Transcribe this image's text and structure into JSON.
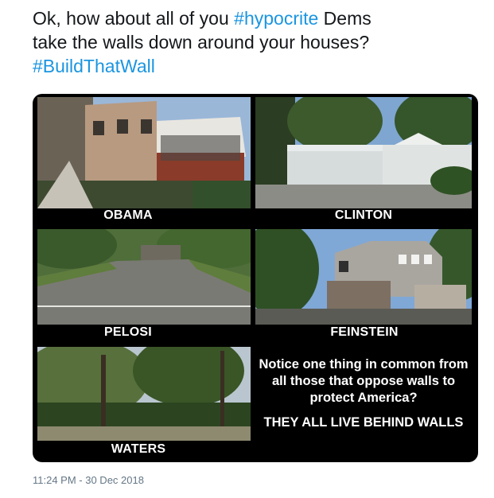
{
  "tweet": {
    "line1_prefix": "Ok, how about all of you ",
    "line1_hashtag": "#hypocrite",
    "line1_suffix": " Dems",
    "line2": "take the walls down around your houses?",
    "line3_hashtag": "#BuildThatWall",
    "timestamp": "11:24 PM - 30 Dec 2018"
  },
  "media": {
    "captions": {
      "obama": "OBAMA",
      "clinton": "CLINTON",
      "pelosi": "PELOSI",
      "feinstein": "FEINSTEIN",
      "waters": "WATERS"
    },
    "notice_text": "Notice one thing in common from all those that oppose walls to protect America?",
    "notice_conclusion": "THEY ALL LIVE BEHIND WALLS"
  },
  "colors": {
    "hashtag": "#1b95e0",
    "text": "#14171a",
    "timestamp": "#657786",
    "media_background": "#000000"
  }
}
